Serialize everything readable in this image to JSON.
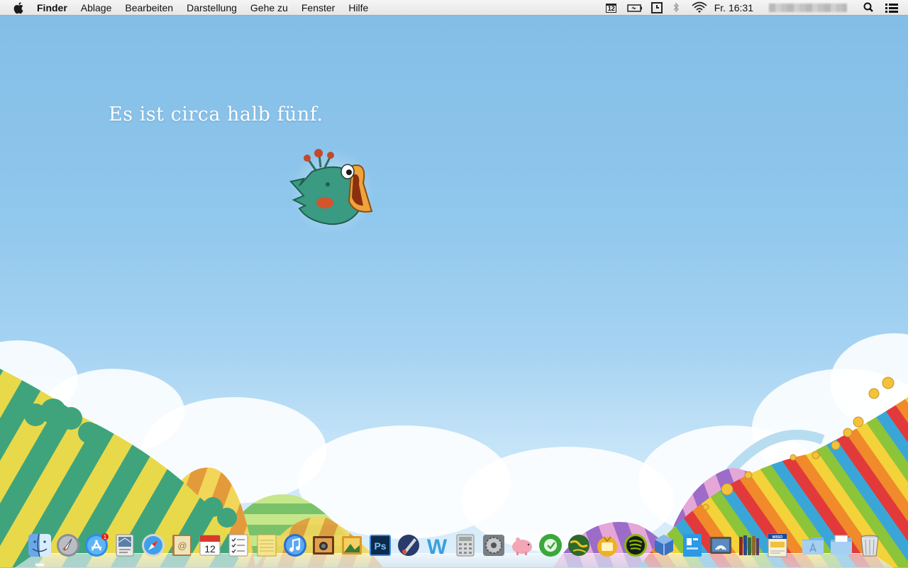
{
  "menubar": {
    "app_name": "Finder",
    "menus": [
      "Ablage",
      "Bearbeiten",
      "Darstellung",
      "Gehe zu",
      "Fenster",
      "Hilfe"
    ],
    "calendar_badge": "12",
    "clock": "Fr. 16:31",
    "status_icons": [
      "calendar-icon",
      "battery-icon",
      "time-machine-icon",
      "bluetooth-icon",
      "wifi-icon",
      "user-name-blurred",
      "spotlight-icon",
      "notification-center-icon"
    ]
  },
  "desktop": {
    "wallpaper_text": "Es ist circa halb fünf."
  },
  "dock": {
    "apps": [
      {
        "name": "finder"
      },
      {
        "name": "launchpad"
      },
      {
        "name": "app-store",
        "badge": "1"
      },
      {
        "name": "mail-stamp"
      },
      {
        "name": "safari"
      },
      {
        "name": "contacts"
      },
      {
        "name": "calendar",
        "date": "12"
      },
      {
        "name": "reminders"
      },
      {
        "name": "notes"
      },
      {
        "name": "itunes"
      },
      {
        "name": "photo-booth"
      },
      {
        "name": "iphoto"
      },
      {
        "name": "photoshop",
        "label": "Ps"
      },
      {
        "name": "pixelmator"
      },
      {
        "name": "word-app",
        "label": "W"
      },
      {
        "name": "calculator"
      },
      {
        "name": "system-preferences"
      },
      {
        "name": "piggy-bank"
      },
      {
        "name": "facetime-green"
      },
      {
        "name": "globe-app"
      },
      {
        "name": "tv-app"
      },
      {
        "name": "spotify"
      },
      {
        "name": "virtualbox"
      },
      {
        "name": "wunderlist-app"
      },
      {
        "name": "image-capture"
      },
      {
        "name": "ibooks"
      },
      {
        "name": "wiso-steuer",
        "label": "WISO"
      },
      {
        "name": "applications-folder"
      },
      {
        "name": "documents-folder"
      },
      {
        "name": "trash"
      }
    ]
  },
  "colors": {
    "sky": "#8ec6ec",
    "menubar": "#ececec",
    "text_white": "#ffffff"
  }
}
